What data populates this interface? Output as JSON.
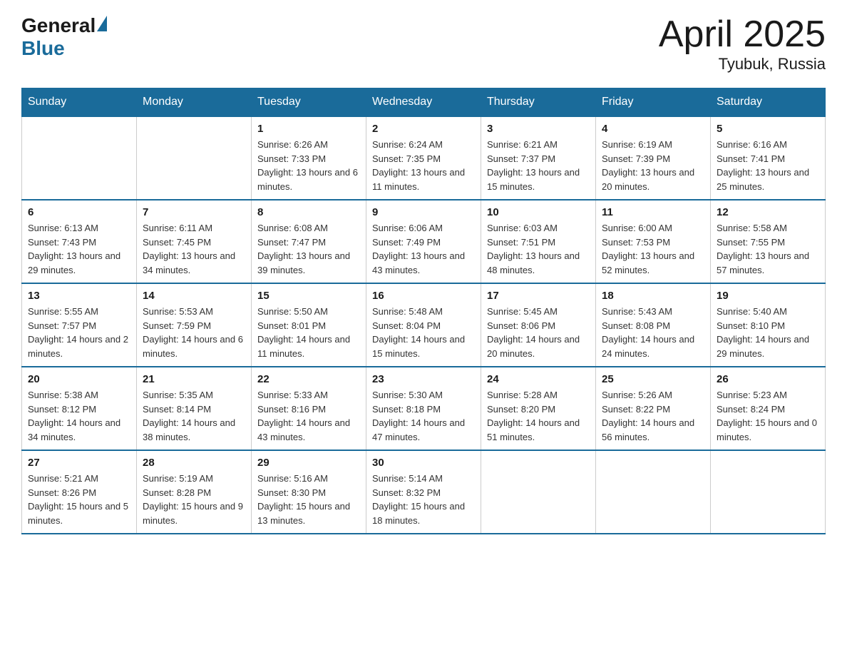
{
  "header": {
    "logo": {
      "part1": "General",
      "part2": "Blue"
    },
    "title": "April 2025",
    "subtitle": "Tyubuk, Russia"
  },
  "weekdays": [
    "Sunday",
    "Monday",
    "Tuesday",
    "Wednesday",
    "Thursday",
    "Friday",
    "Saturday"
  ],
  "weeks": [
    [
      {
        "day": "",
        "sunrise": "",
        "sunset": "",
        "daylight": ""
      },
      {
        "day": "",
        "sunrise": "",
        "sunset": "",
        "daylight": ""
      },
      {
        "day": "1",
        "sunrise": "Sunrise: 6:26 AM",
        "sunset": "Sunset: 7:33 PM",
        "daylight": "Daylight: 13 hours and 6 minutes."
      },
      {
        "day": "2",
        "sunrise": "Sunrise: 6:24 AM",
        "sunset": "Sunset: 7:35 PM",
        "daylight": "Daylight: 13 hours and 11 minutes."
      },
      {
        "day": "3",
        "sunrise": "Sunrise: 6:21 AM",
        "sunset": "Sunset: 7:37 PM",
        "daylight": "Daylight: 13 hours and 15 minutes."
      },
      {
        "day": "4",
        "sunrise": "Sunrise: 6:19 AM",
        "sunset": "Sunset: 7:39 PM",
        "daylight": "Daylight: 13 hours and 20 minutes."
      },
      {
        "day": "5",
        "sunrise": "Sunrise: 6:16 AM",
        "sunset": "Sunset: 7:41 PM",
        "daylight": "Daylight: 13 hours and 25 minutes."
      }
    ],
    [
      {
        "day": "6",
        "sunrise": "Sunrise: 6:13 AM",
        "sunset": "Sunset: 7:43 PM",
        "daylight": "Daylight: 13 hours and 29 minutes."
      },
      {
        "day": "7",
        "sunrise": "Sunrise: 6:11 AM",
        "sunset": "Sunset: 7:45 PM",
        "daylight": "Daylight: 13 hours and 34 minutes."
      },
      {
        "day": "8",
        "sunrise": "Sunrise: 6:08 AM",
        "sunset": "Sunset: 7:47 PM",
        "daylight": "Daylight: 13 hours and 39 minutes."
      },
      {
        "day": "9",
        "sunrise": "Sunrise: 6:06 AM",
        "sunset": "Sunset: 7:49 PM",
        "daylight": "Daylight: 13 hours and 43 minutes."
      },
      {
        "day": "10",
        "sunrise": "Sunrise: 6:03 AM",
        "sunset": "Sunset: 7:51 PM",
        "daylight": "Daylight: 13 hours and 48 minutes."
      },
      {
        "day": "11",
        "sunrise": "Sunrise: 6:00 AM",
        "sunset": "Sunset: 7:53 PM",
        "daylight": "Daylight: 13 hours and 52 minutes."
      },
      {
        "day": "12",
        "sunrise": "Sunrise: 5:58 AM",
        "sunset": "Sunset: 7:55 PM",
        "daylight": "Daylight: 13 hours and 57 minutes."
      }
    ],
    [
      {
        "day": "13",
        "sunrise": "Sunrise: 5:55 AM",
        "sunset": "Sunset: 7:57 PM",
        "daylight": "Daylight: 14 hours and 2 minutes."
      },
      {
        "day": "14",
        "sunrise": "Sunrise: 5:53 AM",
        "sunset": "Sunset: 7:59 PM",
        "daylight": "Daylight: 14 hours and 6 minutes."
      },
      {
        "day": "15",
        "sunrise": "Sunrise: 5:50 AM",
        "sunset": "Sunset: 8:01 PM",
        "daylight": "Daylight: 14 hours and 11 minutes."
      },
      {
        "day": "16",
        "sunrise": "Sunrise: 5:48 AM",
        "sunset": "Sunset: 8:04 PM",
        "daylight": "Daylight: 14 hours and 15 minutes."
      },
      {
        "day": "17",
        "sunrise": "Sunrise: 5:45 AM",
        "sunset": "Sunset: 8:06 PM",
        "daylight": "Daylight: 14 hours and 20 minutes."
      },
      {
        "day": "18",
        "sunrise": "Sunrise: 5:43 AM",
        "sunset": "Sunset: 8:08 PM",
        "daylight": "Daylight: 14 hours and 24 minutes."
      },
      {
        "day": "19",
        "sunrise": "Sunrise: 5:40 AM",
        "sunset": "Sunset: 8:10 PM",
        "daylight": "Daylight: 14 hours and 29 minutes."
      }
    ],
    [
      {
        "day": "20",
        "sunrise": "Sunrise: 5:38 AM",
        "sunset": "Sunset: 8:12 PM",
        "daylight": "Daylight: 14 hours and 34 minutes."
      },
      {
        "day": "21",
        "sunrise": "Sunrise: 5:35 AM",
        "sunset": "Sunset: 8:14 PM",
        "daylight": "Daylight: 14 hours and 38 minutes."
      },
      {
        "day": "22",
        "sunrise": "Sunrise: 5:33 AM",
        "sunset": "Sunset: 8:16 PM",
        "daylight": "Daylight: 14 hours and 43 minutes."
      },
      {
        "day": "23",
        "sunrise": "Sunrise: 5:30 AM",
        "sunset": "Sunset: 8:18 PM",
        "daylight": "Daylight: 14 hours and 47 minutes."
      },
      {
        "day": "24",
        "sunrise": "Sunrise: 5:28 AM",
        "sunset": "Sunset: 8:20 PM",
        "daylight": "Daylight: 14 hours and 51 minutes."
      },
      {
        "day": "25",
        "sunrise": "Sunrise: 5:26 AM",
        "sunset": "Sunset: 8:22 PM",
        "daylight": "Daylight: 14 hours and 56 minutes."
      },
      {
        "day": "26",
        "sunrise": "Sunrise: 5:23 AM",
        "sunset": "Sunset: 8:24 PM",
        "daylight": "Daylight: 15 hours and 0 minutes."
      }
    ],
    [
      {
        "day": "27",
        "sunrise": "Sunrise: 5:21 AM",
        "sunset": "Sunset: 8:26 PM",
        "daylight": "Daylight: 15 hours and 5 minutes."
      },
      {
        "day": "28",
        "sunrise": "Sunrise: 5:19 AM",
        "sunset": "Sunset: 8:28 PM",
        "daylight": "Daylight: 15 hours and 9 minutes."
      },
      {
        "day": "29",
        "sunrise": "Sunrise: 5:16 AM",
        "sunset": "Sunset: 8:30 PM",
        "daylight": "Daylight: 15 hours and 13 minutes."
      },
      {
        "day": "30",
        "sunrise": "Sunrise: 5:14 AM",
        "sunset": "Sunset: 8:32 PM",
        "daylight": "Daylight: 15 hours and 18 minutes."
      },
      {
        "day": "",
        "sunrise": "",
        "sunset": "",
        "daylight": ""
      },
      {
        "day": "",
        "sunrise": "",
        "sunset": "",
        "daylight": ""
      },
      {
        "day": "",
        "sunrise": "",
        "sunset": "",
        "daylight": ""
      }
    ]
  ]
}
